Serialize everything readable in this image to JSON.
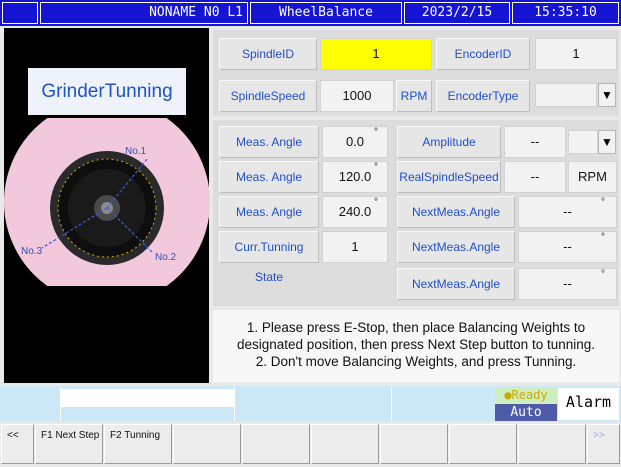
{
  "title_bar": {
    "program": "NONAME N0 L1",
    "screen": "WheelBalance",
    "date": "2023/2/15",
    "time": "15:35:10"
  },
  "left_panel": {
    "title": "GrinderTunning",
    "wheel_labels": [
      "No.1",
      "No.2",
      "No.3"
    ]
  },
  "spindle": {
    "spindle_id_label": "SpindleID",
    "spindle_id_value": "1",
    "encoder_id_label": "EncoderID",
    "encoder_id_value": "1",
    "spindle_speed_label": "SpindleSpeed",
    "spindle_speed_value": "1000",
    "rpm_unit": "RPM",
    "encoder_type_label": "EncoderType",
    "encoder_type_value": ""
  },
  "measurements": {
    "rows": [
      {
        "label": "Meas. Angle",
        "value": "0.0"
      },
      {
        "label": "Meas. Angle",
        "value": "120.0"
      },
      {
        "label": "Meas. Angle",
        "value": "240.0"
      }
    ],
    "curr_state_label": "Curr.Tunning State",
    "curr_state_value": "1",
    "degree_symbol": "°"
  },
  "right_column": {
    "amplitude_label": "Amplitude",
    "amplitude_value": "--",
    "real_speed_label": "RealSpindleSpeed",
    "real_speed_value": "--",
    "real_speed_unit": "RPM",
    "next_meas": [
      {
        "label": "NextMeas.Angle",
        "value": "--"
      },
      {
        "label": "NextMeas.Angle",
        "value": "--"
      },
      {
        "label": "NextMeas.Angle",
        "value": "--"
      }
    ]
  },
  "instructions": {
    "line1": "1. Please press E-Stop, then place Balancing Weights to",
    "line2": "designated position, then press Next Step button to tunning.",
    "line3": "2. Don't move Balancing Weights, and press Tunning."
  },
  "status": {
    "ready": "●Ready",
    "mode": "Auto",
    "alarm": "Alarm"
  },
  "function_keys": {
    "prev": "<<",
    "f1": "F1 Next Step",
    "f2": "F2 Tunning",
    "next": ">>"
  },
  "colors": {
    "title_bar": "#1414d2",
    "highlight": "#ffff00",
    "label_text": "#1f4fc8",
    "wheel": "#f2c8dc"
  }
}
